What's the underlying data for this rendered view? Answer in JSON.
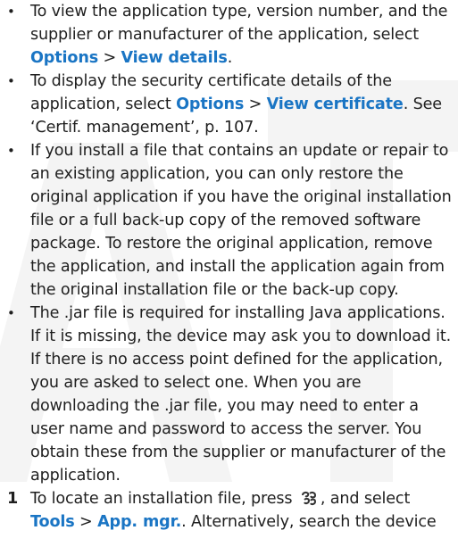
{
  "items": [
    {
      "marker": "•",
      "t1": "To view the application type, version number, and the supplier or manufacturer of the application, select ",
      "b1": "Options",
      "t2": " > ",
      "b2": "View details",
      "t3": "."
    },
    {
      "marker": "•",
      "t1": "To display the security certificate details of the application, select ",
      "b1": "Options",
      "t2": " > ",
      "b2": "View certificate",
      "t3": ". See ‘Certif. management’, p. 107."
    },
    {
      "marker": "•",
      "text": "If you install a file that contains an update or repair to an existing application, you can only restore the original application if you have the original installation file or a full back-up copy of the removed software package. To restore the original application, remove the application, and install the application again from the original installation file or the back-up copy."
    },
    {
      "marker": "•",
      "text": "The .jar file is required for installing Java applications. If it is missing, the device may ask you to download it. If there is no access point defined for the application, you are asked to select one. When you are downloading the .jar file, you may need to enter a user name and password to access the server. You obtain these from the supplier or manufacturer of the application."
    },
    {
      "marker": "1",
      "t1": "To locate an installation file, press ",
      "icon": "menu-key-icon",
      "t2": ", and select ",
      "b1": "Tools",
      "t3": " > ",
      "b2": "App. mgr.",
      "t4": ". Alternatively, search the device"
    }
  ],
  "colors": {
    "link": "#1a75c4",
    "text": "#1f1f1f",
    "watermark": "#f2f2f2"
  }
}
